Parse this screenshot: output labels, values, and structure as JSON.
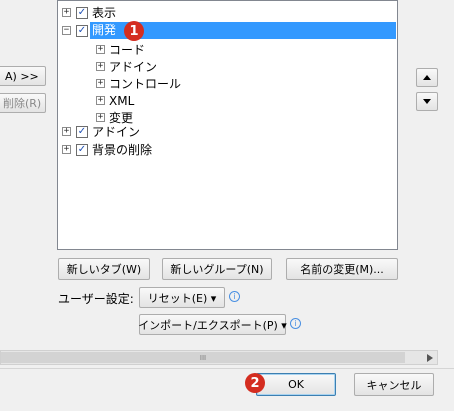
{
  "left_panel": {
    "add_button": "A) >>",
    "remove_button": "削除(R)"
  },
  "tree": {
    "items": [
      {
        "label": "表示",
        "expander": "+",
        "checked": true
      },
      {
        "label": "開発",
        "expander": "−",
        "checked": true
      },
      {
        "label": "コード",
        "expander": "+"
      },
      {
        "label": "アドイン",
        "expander": "+"
      },
      {
        "label": "コントロール",
        "expander": "+"
      },
      {
        "label": "XML",
        "expander": "+"
      },
      {
        "label": "変更",
        "expander": "+"
      },
      {
        "label": "アドイン",
        "expander": "+",
        "checked": true
      },
      {
        "label": "背景の削除",
        "expander": "+",
        "checked": true
      }
    ]
  },
  "buttons": {
    "new_tab": "新しいタブ(W)",
    "new_group": "新しいグループ(N)",
    "rename": "名前の変更(M)..."
  },
  "customize": {
    "label": "ユーザー設定:",
    "reset": "リセット(E) ▾",
    "import_export": "インポート/エクスポート(P) ▾"
  },
  "scroll": {
    "thumb_glyph": "III"
  },
  "footer": {
    "ok": "OK",
    "cancel": "キャンセル"
  },
  "badges": {
    "first": "1",
    "second": "2"
  },
  "colors": {
    "selection": "#3399ff",
    "badge": "#d42d20"
  }
}
